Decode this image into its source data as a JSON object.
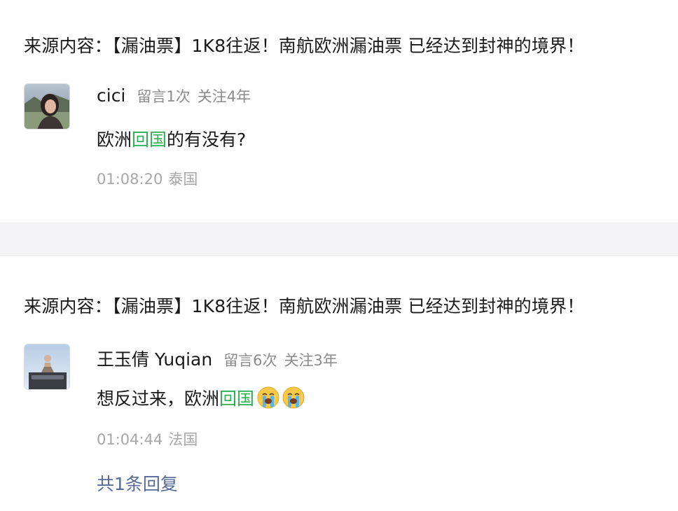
{
  "comments": [
    {
      "source_prefix": "来源内容：",
      "source_title": "【漏油票】1K8往返！南航欧洲漏油票 已经达到封神的境界！",
      "username": "cici",
      "comment_count": "留言1次",
      "follow_duration": "关注4年",
      "text_before": "欧洲",
      "keyword": "回国",
      "text_after": "的有没有?",
      "time": "01:08:20",
      "location": "泰国"
    },
    {
      "source_prefix": "来源内容：",
      "source_title": "【漏油票】1K8往返！南航欧洲漏油票 已经达到封神的境界！",
      "username": "王玉倩 Yuqian",
      "comment_count": "留言6次",
      "follow_duration": "关注3年",
      "text_before": "想反过来，欧洲",
      "keyword": "回国",
      "emojis": [
        "crying-face-icon",
        "crying-face-icon"
      ],
      "time": "01:04:44",
      "location": "法国",
      "replies_label": "共1条回复"
    }
  ],
  "colors": {
    "keyword": "#2fae52",
    "link": "#576b95",
    "meta": "#8a8a8a",
    "divider_bg": "#f3f3f5"
  }
}
